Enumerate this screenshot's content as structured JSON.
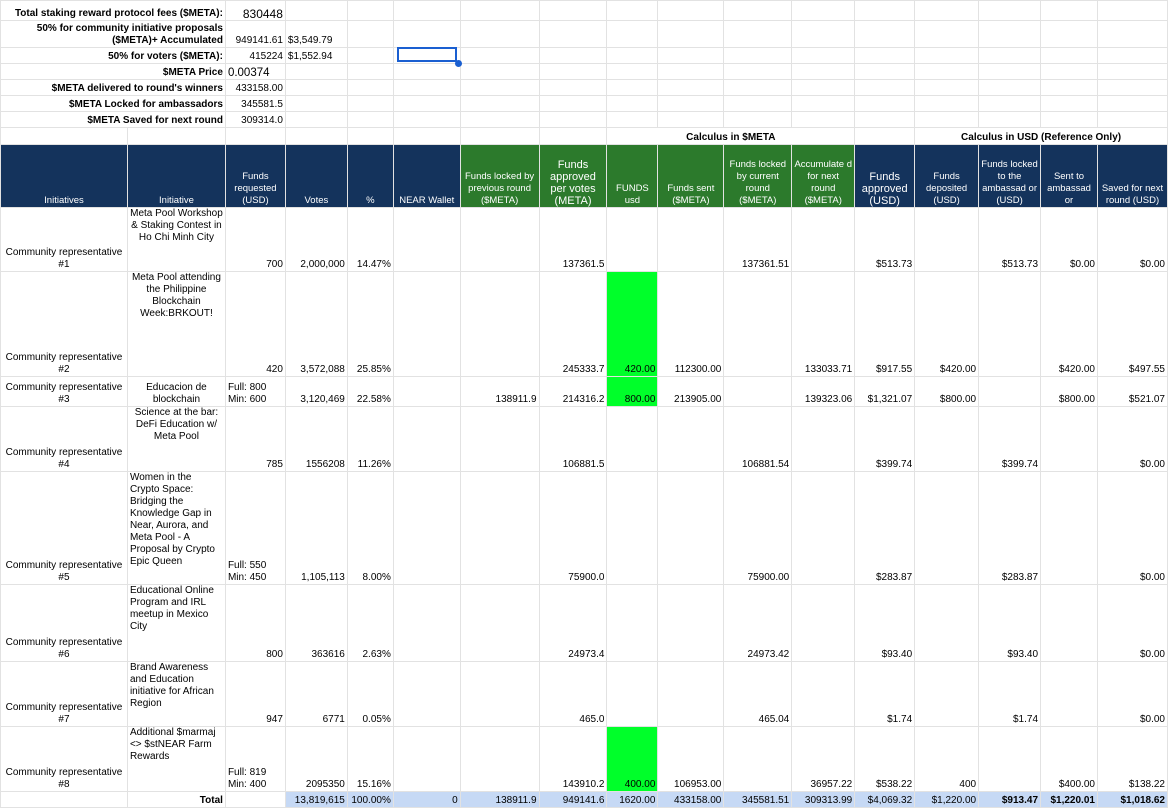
{
  "summary": [
    {
      "label": "Total staking reward protocol fees ($META):",
      "v1": "830448",
      "v2": ""
    },
    {
      "label": "50% for community initiative proposals ($META)+ Accumulated",
      "v1": "949141.61",
      "v2": "$3,549.79"
    },
    {
      "label": "50% for voters ($META):",
      "v1": "415224",
      "v2": "$1,552.94"
    },
    {
      "label": "$META Price",
      "v1": "0.00374",
      "v2": ""
    },
    {
      "label": "$META delivered to round's winners",
      "v1": "433158.00",
      "v2": ""
    },
    {
      "label": "$META Locked for ambassadors",
      "v1": "345581.5",
      "v2": ""
    },
    {
      "label": "$META Saved for next round",
      "v1": "309314.0",
      "v2": ""
    }
  ],
  "group_headers": {
    "meta": "Calculus in $META",
    "usd": "Calculus in USD (Reference Only)"
  },
  "headers": [
    "Initiatives",
    "Initiative",
    "Funds requested (USD)",
    "Votes",
    "%",
    "NEAR Wallet",
    "Funds locked by previous round ($META)",
    "Funds approved per votes (META)",
    "FUNDS usd",
    "Funds sent ($META)",
    "Funds locked by current round ($META)",
    "Accumulate d for next round ($META)",
    "Funds approved (USD)",
    "Funds deposited (USD)",
    "Funds locked to the ambassad or (USD)",
    "Sent to ambassad or",
    "Saved for next round (USD)"
  ],
  "rows": [
    [
      "Community representative #1",
      "Meta Pool Workshop & Staking Contest in Ho Chi Minh City",
      "700",
      "2,000,000",
      "14.47%",
      "",
      "",
      "137361.5",
      "",
      "",
      "137361.51",
      "",
      "$513.73",
      "",
      "$513.73",
      "$0.00",
      "$0.00"
    ],
    [
      "Community representative #2",
      "Meta Pool attending the Philippine Blockchain Week:BRKOUT!",
      "420",
      "3,572,088",
      "25.85%",
      "",
      "",
      "245333.7",
      "420.00",
      "112300.00",
      "",
      "133033.71",
      "$917.55",
      "$420.00",
      "",
      "$420.00",
      "$497.55"
    ],
    [
      "Community representative #3",
      "Educacion de blockchain",
      "Full: 800 Min: 600",
      "3,120,469",
      "22.58%",
      "",
      "138911.9",
      "214316.2",
      "800.00",
      "213905.00",
      "",
      "139323.06",
      "$1,321.07",
      "$800.00",
      "",
      "$800.00",
      "$521.07"
    ],
    [
      "Community representative #4",
      "Science at the bar: DeFi Education w/ Meta Pool",
      "785",
      "1556208",
      "11.26%",
      "",
      "",
      "106881.5",
      "",
      "",
      "106881.54",
      "",
      "$399.74",
      "",
      "$399.74",
      "",
      "$0.00"
    ],
    [
      "Community representative #5",
      "Women in the Crypto Space: Bridging the Knowledge Gap in Near, Aurora, and Meta Pool - A Proposal by Crypto Epic Queen",
      "Full: 550 Min: 450",
      "1,105,113",
      "8.00%",
      "",
      "",
      "75900.0",
      "",
      "",
      "75900.00",
      "",
      "$283.87",
      "",
      "$283.87",
      "",
      "$0.00"
    ],
    [
      "Community representative #6",
      "Educational Online Program and IRL meetup in Mexico City",
      "800",
      "363616",
      "2.63%",
      "",
      "",
      "24973.4",
      "",
      "",
      "24973.42",
      "",
      "$93.40",
      "",
      "$93.40",
      "",
      "$0.00"
    ],
    [
      "Community representative #7",
      "Brand Awareness and Education initiative for African Region",
      "947",
      "6771",
      "0.05%",
      "",
      "",
      "465.0",
      "",
      "",
      "465.04",
      "",
      "$1.74",
      "",
      "$1.74",
      "",
      "$0.00"
    ],
    [
      "Community representative #8",
      "Additional $marmaj <> $stNEAR Farm Rewards",
      "Full: 819 Min: 400",
      "2095350",
      "15.16%",
      "",
      "",
      "143910.2",
      "400.00",
      "106953.00",
      "",
      "36957.22",
      "$538.22",
      "400",
      "",
      "$400.00",
      "$138.22"
    ]
  ],
  "total": [
    "",
    "Total",
    "",
    "13,819,615",
    "100.00%",
    "0",
    "138911.9",
    "949141.6",
    "1620.00",
    "433158.00",
    "345581.51",
    "309313.99",
    "$4,069.32",
    "$1,220.00",
    "$913.47",
    "$1,220.01",
    "$1,018.62"
  ]
}
